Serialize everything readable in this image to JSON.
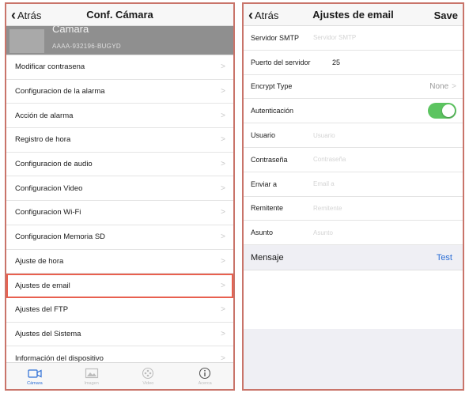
{
  "left": {
    "back_label": "Atrás",
    "title": "Conf. Cámara",
    "camera": {
      "name": "Camara",
      "id": "AAAA-932196-BUGYD"
    },
    "menu": [
      {
        "label": "Modificar contrasena"
      },
      {
        "label": "Configuracion de la alarma"
      },
      {
        "label": "Acción de alarma"
      },
      {
        "label": "Registro de hora"
      },
      {
        "label": "Configuracion de audio"
      },
      {
        "label": "Configuracion Video"
      },
      {
        "label": "Configuracion Wi-Fi"
      },
      {
        "label": "Configuracion Memoria SD"
      },
      {
        "label": "Ajuste de hora"
      },
      {
        "label": "Ajustes de email",
        "highlighted": true
      },
      {
        "label": "Ajustes del FTP"
      },
      {
        "label": "Ajustes del Sistema"
      },
      {
        "label": "Información del dispositivo"
      }
    ],
    "tabs": [
      {
        "label": "Cámara",
        "icon": "camera-icon",
        "active": true
      },
      {
        "label": "Imagen",
        "icon": "image-icon",
        "active": false
      },
      {
        "label": "Video",
        "icon": "video-icon",
        "active": false
      },
      {
        "label": "Acerca",
        "icon": "info-icon",
        "active": false
      }
    ]
  },
  "right": {
    "back_label": "Atrás",
    "title": "Ajustes de email",
    "save_label": "Save",
    "smtp": {
      "label": "Servidor SMTP",
      "placeholder": "Servidor SMTP",
      "value": ""
    },
    "port": {
      "label": "Puerto del servidor",
      "value": "25"
    },
    "encrypt": {
      "label": "Encrypt Type",
      "value": "None"
    },
    "auth": {
      "label": "Autenticación",
      "enabled": true
    },
    "user": {
      "label": "Usuario",
      "placeholder": "Usuario",
      "value": ""
    },
    "password": {
      "label": "Contraseña",
      "placeholder": "Contraseña",
      "value": ""
    },
    "send_to": {
      "label": "Enviar a",
      "placeholder": "Email a",
      "value": ""
    },
    "sender": {
      "label": "Remitente",
      "placeholder": "Remitente",
      "value": ""
    },
    "subject": {
      "label": "Asunto",
      "placeholder": "Asunto",
      "value": ""
    },
    "message": {
      "label": "Mensaje",
      "test_label": "Test"
    }
  },
  "colors": {
    "accent_blue": "#2d6fd6",
    "toggle_green": "#5cc460",
    "highlight_red": "#e8604f"
  }
}
